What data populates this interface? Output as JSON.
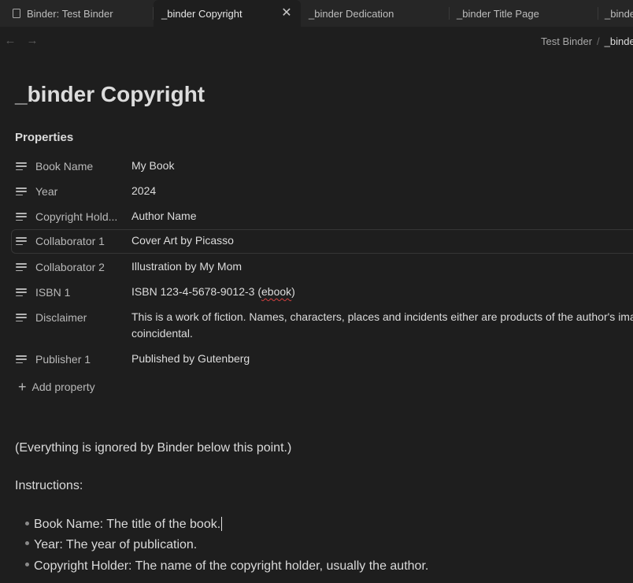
{
  "tabs": [
    {
      "label": "Binder: Test Binder",
      "has_icon": true
    },
    {
      "label": "_binder Copyright",
      "active": true
    },
    {
      "label": "_binder Dedication"
    },
    {
      "label": "_binder Title Page"
    },
    {
      "label": "_binde"
    }
  ],
  "nav": {
    "back_icon": "arrow-left-icon",
    "forward_icon": "arrow-right-icon"
  },
  "breadcrumb": {
    "parent": "Test Binder",
    "separator": "/",
    "current": "_binder"
  },
  "page": {
    "title": "_binder Copyright"
  },
  "properties": {
    "heading": "Properties",
    "items": [
      {
        "key": "Book Name",
        "value": "My Book"
      },
      {
        "key": "Year",
        "value": "2024"
      },
      {
        "key": "Copyright Hold...",
        "value": "Author Name"
      },
      {
        "key": "Collaborator 1",
        "value": "Cover Art by Picasso"
      },
      {
        "key": "Collaborator 2",
        "value": "Illustration by My Mom"
      },
      {
        "key": "ISBN 1",
        "value_prefix": "ISBN 123-4-5678-9012-3 (",
        "value_flagged": "ebook",
        "value_suffix": ")"
      },
      {
        "key": "Disclaimer",
        "value": "This is a work of fiction. Names, characters, places and incidents either are products of the author's imag coincidental."
      },
      {
        "key": "Publisher 1",
        "value": "Published by Gutenberg"
      }
    ],
    "add_label": "Add property"
  },
  "content": {
    "note": "(Everything is ignored by Binder below this point.)",
    "instructions_heading": "Instructions:",
    "bullets": [
      "Book Name: The title of the book.",
      "Year: The year of publication.",
      "Copyright Holder: The name of the copyright holder, usually the author."
    ]
  },
  "colors": {
    "background": "#1e1e1e",
    "tabbar": "#262626",
    "text": "#dadada",
    "spellcheck": "#d04040"
  }
}
